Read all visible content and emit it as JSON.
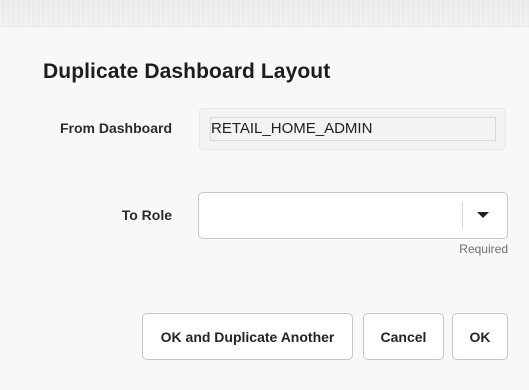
{
  "dialog": {
    "title": "Duplicate Dashboard Layout"
  },
  "form": {
    "from_dashboard": {
      "label": "From Dashboard",
      "value": "RETAIL_HOME_ADMIN"
    },
    "to_role": {
      "label": "To Role",
      "value": "",
      "helper_text": "Required",
      "icon": "chevron-down-icon"
    }
  },
  "buttons": {
    "ok_and_duplicate_another": "OK and Duplicate Another",
    "cancel": "Cancel",
    "ok": "OK"
  },
  "colors": {
    "background": "#f8f8f7",
    "field_background": "#ffffff",
    "readonly_background": "#f3f3f2",
    "border": "#c9c9c6",
    "text": "#1f1f1f",
    "muted_text": "#6f6f6f"
  }
}
